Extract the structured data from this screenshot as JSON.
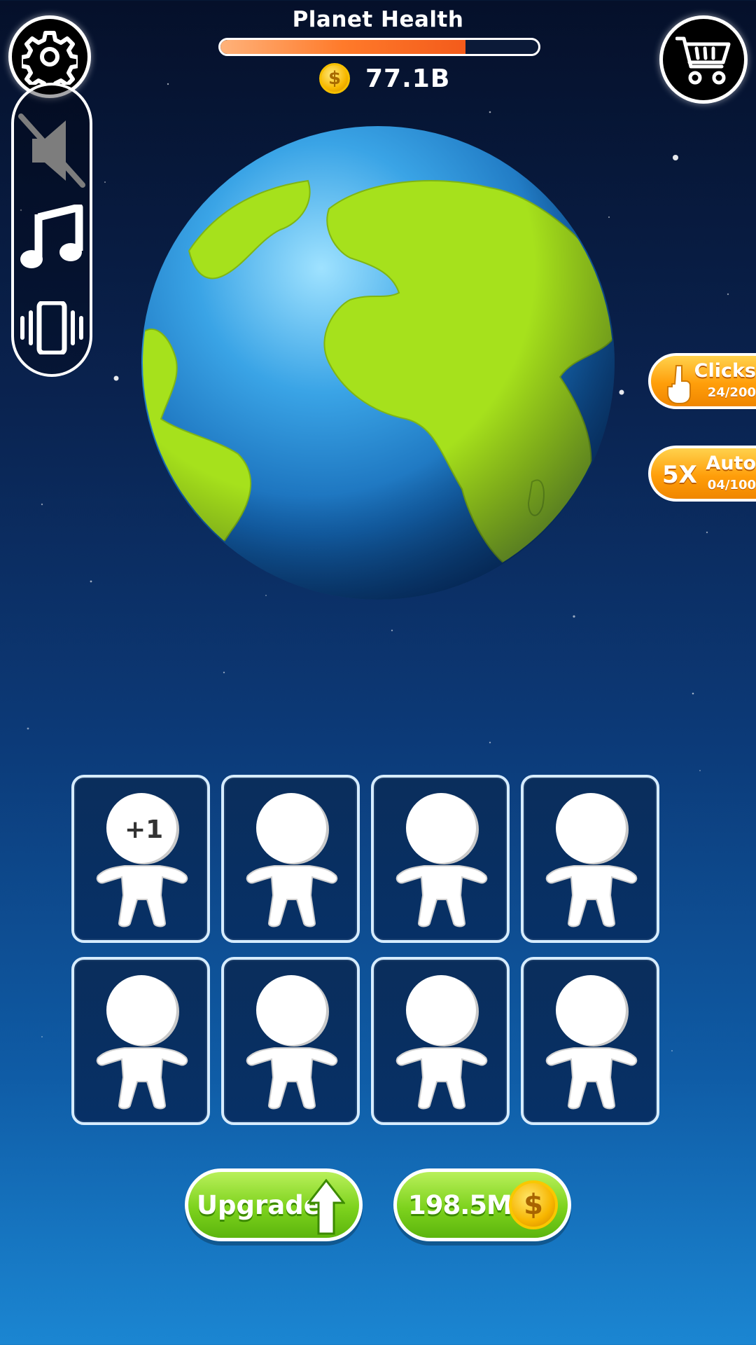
{
  "header": {
    "title": "Planet Health",
    "health_fraction": 0.77,
    "coins": "77.1B",
    "coin_symbol": "$"
  },
  "side_controls": [
    "mute-icon",
    "music-icon",
    "vibrate-icon"
  ],
  "boosts": {
    "clicks": {
      "label": "Clicks",
      "count": "24/200"
    },
    "auto": {
      "multiplier": "5X",
      "label": "Auto",
      "count": "04/100"
    }
  },
  "grid": {
    "rows": 2,
    "cols": 4,
    "first_cell_badge": "+1"
  },
  "actions": {
    "upgrade_label": "Upgrade",
    "price_label": "198.5M",
    "price_coin_symbol": "$"
  },
  "colors": {
    "health_fill": "#f35b1b",
    "boost_orange": "#ff9e0a",
    "button_green": "#7dd21d",
    "coin_gold": "#f7b800"
  }
}
